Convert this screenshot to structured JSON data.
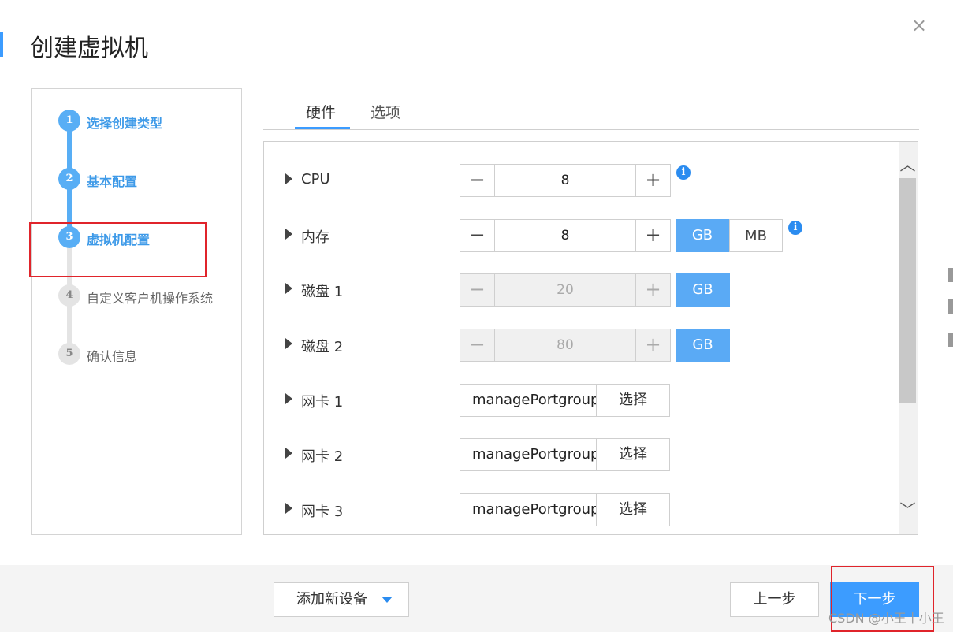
{
  "dialog": {
    "title": "创建虚拟机",
    "close_label": "×"
  },
  "steps": [
    {
      "num": "1",
      "label": "选择创建类型",
      "state": "done"
    },
    {
      "num": "2",
      "label": "基本配置",
      "state": "done"
    },
    {
      "num": "3",
      "label": "虚拟机配置",
      "state": "current"
    },
    {
      "num": "4",
      "label": "自定义客户机操作系统",
      "state": "pending"
    },
    {
      "num": "5",
      "label": "确认信息",
      "state": "pending"
    }
  ],
  "tabs": [
    {
      "label": "硬件",
      "active": true
    },
    {
      "label": "选项",
      "active": false
    }
  ],
  "hardware": {
    "cpu": {
      "label": "CPU",
      "value": "8"
    },
    "memory": {
      "label": "内存",
      "value": "8",
      "unit_gb": "GB",
      "unit_mb": "MB",
      "selected_unit": "GB"
    },
    "disk1": {
      "label": "磁盘 1",
      "value": "20",
      "unit": "GB"
    },
    "disk2": {
      "label": "磁盘 2",
      "value": "80",
      "unit": "GB"
    },
    "nic1": {
      "label": "网卡 1",
      "value": "managePortgroup",
      "button": "选择"
    },
    "nic2": {
      "label": "网卡 2",
      "value": "managePortgroup",
      "button": "选择"
    },
    "nic3": {
      "label": "网卡 3",
      "value": "managePortgroup",
      "button": "选择"
    },
    "minus_glyph": "−",
    "plus_glyph": "+",
    "info_glyph": "i"
  },
  "footer": {
    "add_device": "添加新设备",
    "prev": "上一步",
    "next": "下一步",
    "watermark": "CSDN @小王丨小王"
  },
  "colors": {
    "accent": "#3c9cff",
    "step_active": "#58aef5",
    "highlight": "#e0242b"
  },
  "icons": {
    "close": "close-icon",
    "expand": "caret-right-icon",
    "info": "info-icon",
    "dropdown": "caret-down-icon",
    "scroll_up": "chevron-up-icon",
    "scroll_down": "chevron-down-icon"
  }
}
